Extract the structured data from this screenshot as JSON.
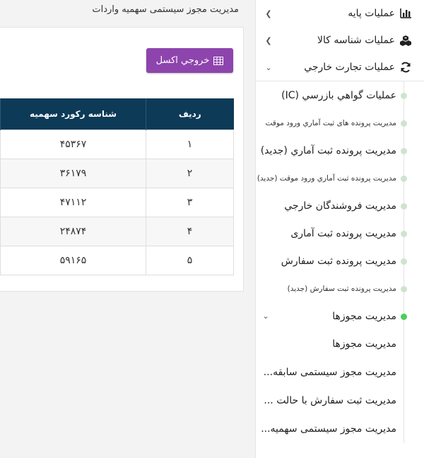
{
  "page": {
    "title": "مدیریت مجوز سیستمی سهمیه واردات"
  },
  "toolbar": {
    "excel_label": "خروجي اكسل"
  },
  "table": {
    "headers": {
      "row": "رديف",
      "record_id": "شناسه رکورد سهمیه"
    },
    "rows": [
      {
        "row": "۱",
        "record_id": "۴۵۳۶۷"
      },
      {
        "row": "۲",
        "record_id": "۳۶۱۷۹"
      },
      {
        "row": "۳",
        "record_id": "۴۷۱۱۲"
      },
      {
        "row": "۴",
        "record_id": "۲۴۸۷۴"
      },
      {
        "row": "۵",
        "record_id": "۵۹۱۶۵"
      }
    ]
  },
  "sidebar": {
    "top_items": [
      {
        "label": "عملیات پایه",
        "icon": "bar-chart-icon"
      },
      {
        "label": "عملیات شناسه کالا",
        "icon": "cubes-icon"
      },
      {
        "label": "عملیات تجارت خارجي",
        "icon": "refresh-icon"
      }
    ],
    "sub_items": [
      "عمليات گواهي بازرسي (IC)",
      "مدیریت پرونده های ثبت آماري ورود موقت",
      "مدیریت پرونده ثبت آماري (جدید)",
      "مدیریت پرونده ثبت آماري ورود موقت (جدید)",
      "مدیریت فروشندگان خارجي",
      "مدیریت پرونده ثبت آماری",
      "مدیریت پرونده ثبت سفارش",
      "مدیریت پرونده ثبت سفارش (جدید)"
    ],
    "active_item": "مديريت مجوزها",
    "nested_items": [
      "مدیریت مجوزها",
      "مدیریت مجوز سیستمی سابقه...",
      "مدیریت ثبت سفارش با حالت ...",
      "مدیریت مجوز سیستمی سهمیه..."
    ]
  },
  "colors": {
    "header_bg": "#0d3a57",
    "excel_button": "#8e44ad",
    "active_dot": "#4ccd5c",
    "inactive_dot": "#cfe3cf"
  }
}
